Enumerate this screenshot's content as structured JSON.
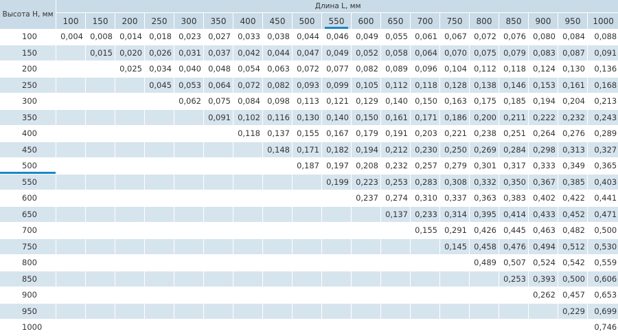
{
  "corner_label": "Высота H, мм",
  "length_label": "Длина L, мм",
  "selected_col": "550",
  "selected_row": "500",
  "accent_color": "#1a86c8",
  "stripe_color": "#d6e4ee",
  "columns": [
    "100",
    "150",
    "200",
    "250",
    "300",
    "350",
    "400",
    "450",
    "500",
    "550",
    "600",
    "650",
    "700",
    "750",
    "800",
    "850",
    "900",
    "950",
    "1000"
  ],
  "rows": [
    {
      "h": "100",
      "cells": [
        "0,004",
        "0,008",
        "0,014",
        "0,018",
        "0,023",
        "0,027",
        "0,033",
        "0,038",
        "0,044",
        "0,046",
        "0,049",
        "0,055",
        "0,061",
        "0,067",
        "0,072",
        "0,076",
        "0,080",
        "0,084",
        "0,088"
      ]
    },
    {
      "h": "150",
      "cells": [
        "",
        "0,015",
        "0,020",
        "0,026",
        "0,031",
        "0,037",
        "0,042",
        "0,044",
        "0,047",
        "0,049",
        "0,052",
        "0,058",
        "0,064",
        "0,070",
        "0,075",
        "0,079",
        "0,083",
        "0,087",
        "0,091"
      ]
    },
    {
      "h": "200",
      "cells": [
        "",
        "",
        "0,025",
        "0,034",
        "0,040",
        "0,048",
        "0,054",
        "0,063",
        "0,072",
        "0,077",
        "0,082",
        "0,089",
        "0,096",
        "0,104",
        "0,112",
        "0,118",
        "0,124",
        "0,130",
        "0,136"
      ]
    },
    {
      "h": "250",
      "cells": [
        "",
        "",
        "",
        "0,045",
        "0,053",
        "0,064",
        "0,072",
        "0,082",
        "0,093",
        "0,099",
        "0,105",
        "0,112",
        "0,118",
        "0,128",
        "0,138",
        "0,146",
        "0,153",
        "0,161",
        "0,168"
      ]
    },
    {
      "h": "300",
      "cells": [
        "",
        "",
        "",
        "",
        "0,062",
        "0,075",
        "0,084",
        "0,098",
        "0,113",
        "0,121",
        "0,129",
        "0,140",
        "0,150",
        "0,163",
        "0,175",
        "0,185",
        "0,194",
        "0,204",
        "0,213"
      ]
    },
    {
      "h": "350",
      "cells": [
        "",
        "",
        "",
        "",
        "",
        "0,091",
        "0,102",
        "0,116",
        "0,130",
        "0,140",
        "0,150",
        "0,161",
        "0,171",
        "0,186",
        "0,200",
        "0,211",
        "0,222",
        "0,232",
        "0,243"
      ]
    },
    {
      "h": "400",
      "cells": [
        "",
        "",
        "",
        "",
        "",
        "",
        "0,118",
        "0,137",
        "0,155",
        "0,167",
        "0,179",
        "0,191",
        "0,203",
        "0,221",
        "0,238",
        "0,251",
        "0,264",
        "0,276",
        "0,289"
      ]
    },
    {
      "h": "450",
      "cells": [
        "",
        "",
        "",
        "",
        "",
        "",
        "",
        "0,148",
        "0,171",
        "0,182",
        "0,194",
        "0,212",
        "0,230",
        "0,250",
        "0,269",
        "0,284",
        "0,298",
        "0,313",
        "0,327"
      ]
    },
    {
      "h": "500",
      "cells": [
        "",
        "",
        "",
        "",
        "",
        "",
        "",
        "",
        "0,187",
        "0,197",
        "0,208",
        "0,232",
        "0,257",
        "0,279",
        "0,301",
        "0,317",
        "0,333",
        "0,349",
        "0,365"
      ]
    },
    {
      "h": "550",
      "cells": [
        "",
        "",
        "",
        "",
        "",
        "",
        "",
        "",
        "",
        "0,199",
        "0,223",
        "0,253",
        "0,283",
        "0,308",
        "0,332",
        "0,350",
        "0,367",
        "0,385",
        "0,403"
      ]
    },
    {
      "h": "600",
      "cells": [
        "",
        "",
        "",
        "",
        "",
        "",
        "",
        "",
        "",
        "",
        "0,237",
        "0,274",
        "0,310",
        "0,337",
        "0,363",
        "0,383",
        "0,402",
        "0,422",
        "0,441"
      ]
    },
    {
      "h": "650",
      "cells": [
        "",
        "",
        "",
        "",
        "",
        "",
        "",
        "",
        "",
        "",
        "",
        "0,137",
        "0,233",
        "0,314",
        "0,395",
        "0,414",
        "0,433",
        "0,452",
        "0,471"
      ]
    },
    {
      "h": "700",
      "cells": [
        "",
        "",
        "",
        "",
        "",
        "",
        "",
        "",
        "",
        "",
        "",
        "",
        "0,155",
        "0,291",
        "0,426",
        "0,445",
        "0,463",
        "0,482",
        "0,500"
      ]
    },
    {
      "h": "750",
      "cells": [
        "",
        "",
        "",
        "",
        "",
        "",
        "",
        "",
        "",
        "",
        "",
        "",
        "",
        "0,145",
        "0,458",
        "0,476",
        "0,494",
        "0,512",
        "0,530"
      ]
    },
    {
      "h": "800",
      "cells": [
        "",
        "",
        "",
        "",
        "",
        "",
        "",
        "",
        "",
        "",
        "",
        "",
        "",
        "",
        "0,489",
        "0,507",
        "0,524",
        "0,542",
        "0,559"
      ]
    },
    {
      "h": "850",
      "cells": [
        "",
        "",
        "",
        "",
        "",
        "",
        "",
        "",
        "",
        "",
        "",
        "",
        "",
        "",
        "",
        "0,253",
        "0,393",
        "0,500",
        "0,606"
      ]
    },
    {
      "h": "900",
      "cells": [
        "",
        "",
        "",
        "",
        "",
        "",
        "",
        "",
        "",
        "",
        "",
        "",
        "",
        "",
        "",
        "",
        "0,262",
        "0,457",
        "0,653"
      ]
    },
    {
      "h": "950",
      "cells": [
        "",
        "",
        "",
        "",
        "",
        "",
        "",
        "",
        "",
        "",
        "",
        "",
        "",
        "",
        "",
        "",
        "",
        "0,229",
        "0,699"
      ]
    },
    {
      "h": "1000",
      "cells": [
        "",
        "",
        "",
        "",
        "",
        "",
        "",
        "",
        "",
        "",
        "",
        "",
        "",
        "",
        "",
        "",
        "",
        "",
        "0,746"
      ]
    }
  ]
}
